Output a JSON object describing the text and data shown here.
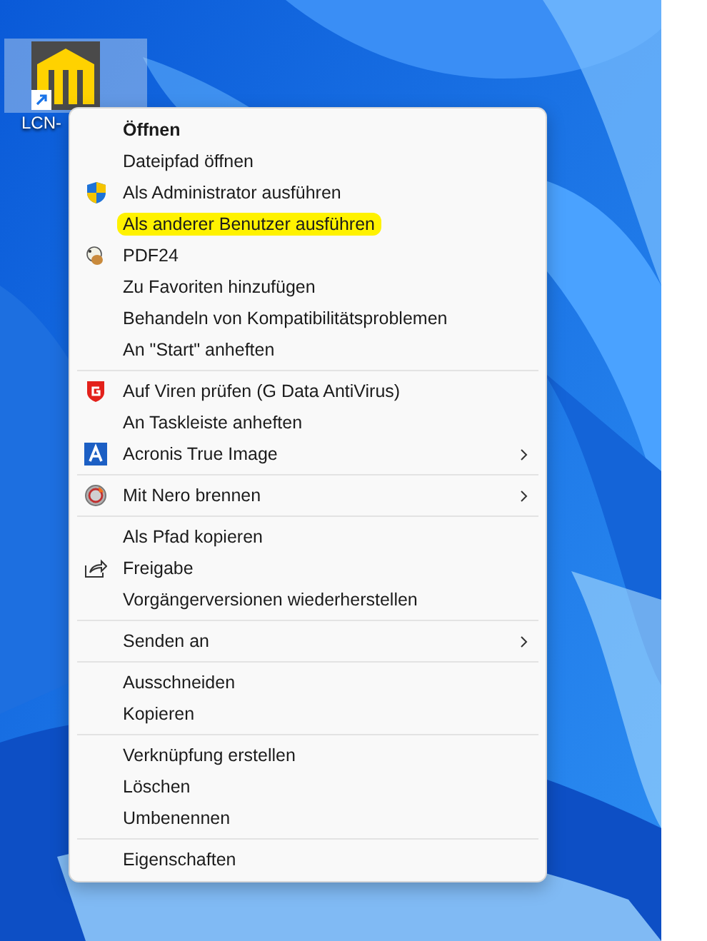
{
  "desktop_icon": {
    "label": "LCN-",
    "shortcut": true
  },
  "context_menu": {
    "sections": [
      {
        "items": [
          {
            "label": "Öffnen",
            "bold": true,
            "kind": "plain",
            "submenu": false,
            "highlighted": false
          },
          {
            "label": "Dateipfad öffnen",
            "bold": false,
            "kind": "plain",
            "submenu": false,
            "highlighted": false
          },
          {
            "label": "Als Administrator ausführen",
            "bold": false,
            "kind": "shield",
            "submenu": false,
            "highlighted": false
          },
          {
            "label": "Als anderer Benutzer ausführen",
            "bold": false,
            "kind": "plain",
            "submenu": false,
            "highlighted": true
          },
          {
            "label": "PDF24",
            "bold": false,
            "kind": "sheep",
            "submenu": false,
            "highlighted": false
          },
          {
            "label": "Zu Favoriten hinzufügen",
            "bold": false,
            "kind": "plain",
            "submenu": false,
            "highlighted": false
          },
          {
            "label": "Behandeln von Kompatibilitätsproblemen",
            "bold": false,
            "kind": "plain",
            "submenu": false,
            "highlighted": false
          },
          {
            "label": "An \"Start\" anheften",
            "bold": false,
            "kind": "plain",
            "submenu": false,
            "highlighted": false
          }
        ]
      },
      {
        "items": [
          {
            "label": "Auf Viren prüfen (G Data AntiVirus)",
            "bold": false,
            "kind": "redshield",
            "submenu": false,
            "highlighted": false
          },
          {
            "label": "An Taskleiste anheften",
            "bold": false,
            "kind": "plain",
            "submenu": false,
            "highlighted": false
          },
          {
            "label": "Acronis True Image",
            "bold": false,
            "kind": "letter",
            "submenu": true,
            "highlighted": false
          }
        ]
      },
      {
        "items": [
          {
            "label": "Mit Nero brennen",
            "bold": false,
            "kind": "disc",
            "submenu": true,
            "highlighted": false
          }
        ]
      },
      {
        "items": [
          {
            "label": "Als Pfad kopieren",
            "bold": false,
            "kind": "plain",
            "submenu": false,
            "highlighted": false
          },
          {
            "label": "Freigabe",
            "bold": false,
            "kind": "share",
            "submenu": false,
            "highlighted": false
          },
          {
            "label": "Vorgängerversionen wiederherstellen",
            "bold": false,
            "kind": "plain",
            "submenu": false,
            "highlighted": false
          }
        ]
      },
      {
        "items": [
          {
            "label": "Senden an",
            "bold": false,
            "kind": "plain",
            "submenu": true,
            "highlighted": false
          }
        ]
      },
      {
        "items": [
          {
            "label": "Ausschneiden",
            "bold": false,
            "kind": "plain",
            "submenu": false,
            "highlighted": false
          },
          {
            "label": "Kopieren",
            "bold": false,
            "kind": "plain",
            "submenu": false,
            "highlighted": false
          }
        ]
      },
      {
        "items": [
          {
            "label": "Verknüpfung erstellen",
            "bold": false,
            "kind": "plain",
            "submenu": false,
            "highlighted": false
          },
          {
            "label": "Löschen",
            "bold": false,
            "kind": "plain",
            "submenu": false,
            "highlighted": false
          },
          {
            "label": "Umbenennen",
            "bold": false,
            "kind": "plain",
            "submenu": false,
            "highlighted": false
          }
        ]
      },
      {
        "items": [
          {
            "label": "Eigenschaften",
            "bold": false,
            "kind": "plain",
            "submenu": false,
            "highlighted": false
          }
        ]
      }
    ]
  }
}
